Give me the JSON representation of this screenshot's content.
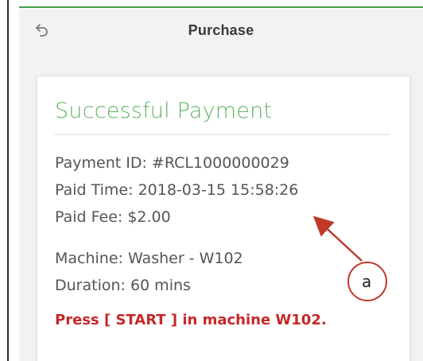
{
  "header": {
    "title": "Purchase",
    "back_icon": "back-arrow-icon"
  },
  "card": {
    "title": "Successful Payment",
    "payment_id": "Payment ID: #RCL1000000029",
    "paid_time": "Paid Time: 2018-03-15 15:58:26",
    "paid_fee": "Paid Fee: $2.00",
    "machine": "Machine: Washer - W102",
    "duration": "Duration: 60 mins",
    "instruction": "Press [ START ] in machine W102."
  },
  "annotation": {
    "label": "a"
  },
  "colors": {
    "accent_green": "#43a047",
    "title_green": "#5fb35f",
    "instruction_red": "#c62828",
    "annotation_red": "#c0392b"
  }
}
